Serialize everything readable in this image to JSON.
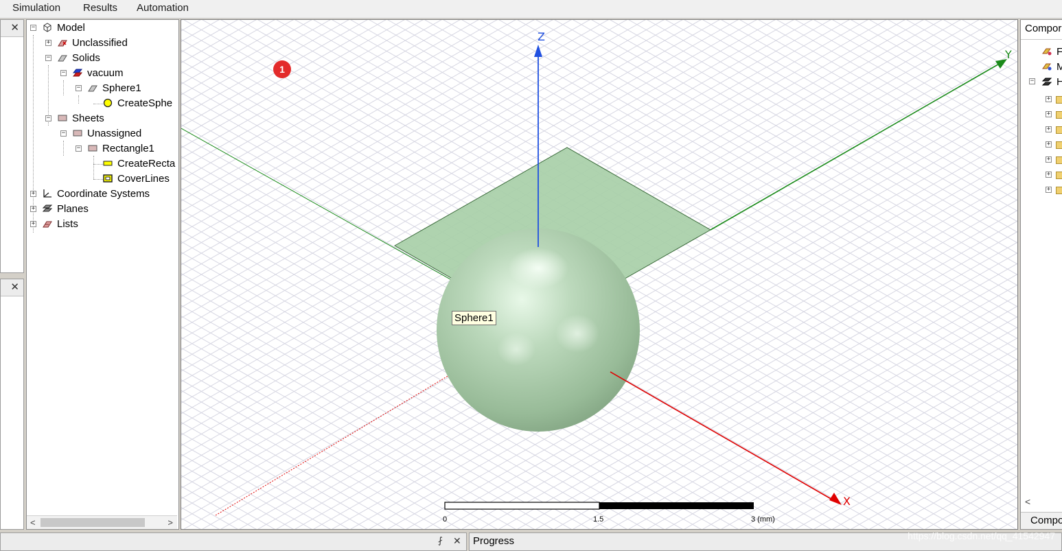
{
  "menu": {
    "items": [
      "Simulation",
      "Results",
      "Automation"
    ]
  },
  "tree": {
    "model": "Model",
    "unclassified": "Unclassified",
    "solids": "Solids",
    "vacuum": "vacuum",
    "sphere1": "Sphere1",
    "create_sphere": "CreateSphe",
    "sheets": "Sheets",
    "unassigned": "Unassigned",
    "rectangle1": "Rectangle1",
    "create_rect": "CreateRecta",
    "cover_lines": "CoverLines",
    "coord_systems": "Coordinate Systems",
    "planes": "Planes",
    "lists": "Lists"
  },
  "viewport": {
    "tooltip": "Sphere1",
    "marker": "1",
    "axes": {
      "x": "X",
      "y": "Y",
      "z": "Z"
    },
    "scale": {
      "ticks": [
        "0",
        "1.5",
        "3 (mm)"
      ]
    },
    "colors": {
      "x_axis": "#e00000",
      "y_axis": "#1a8a1a",
      "z_axis": "#2050e0",
      "object": "#a8c8a8"
    }
  },
  "right_panel": {
    "title": "Compor",
    "bottom_tab": "Compo",
    "items": [
      "F",
      "M",
      "H"
    ]
  },
  "bottom": {
    "progress": "Progress",
    "pin": "⨏",
    "close": "✕"
  },
  "left_panels": {
    "close": "✕"
  },
  "watermark": "https://blog.csdn.net/qq_41542947"
}
